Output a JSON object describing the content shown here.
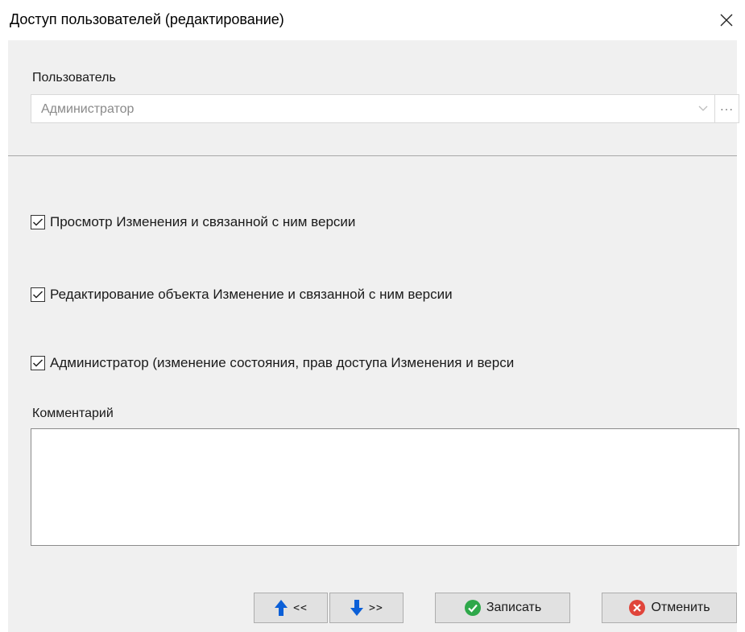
{
  "window": {
    "title": "Доступ пользователей (редактирование)",
    "close_icon": "close-icon"
  },
  "user_field": {
    "label": "Пользователь",
    "value": "Администратор",
    "dropdown_icon": "chevron-down-icon",
    "ellipsis_label": "···"
  },
  "permissions": [
    {
      "label": "Просмотр Изменения и связанной с ним версии",
      "checked": true
    },
    {
      "label": "Редактирование объекта Изменение и связанной с ним версии",
      "checked": true
    },
    {
      "label": "Администратор (изменение состояния, прав доступа Изменения и верси",
      "checked": true
    }
  ],
  "comment": {
    "label": "Комментарий",
    "value": ""
  },
  "buttons": {
    "prev_label": "<<",
    "next_label": ">>",
    "save_label": "Записать",
    "cancel_label": "Отменить"
  },
  "colors": {
    "accent_blue": "#0b5fd7",
    "save_green": "#2ea84a",
    "cancel_red": "#e0443a"
  }
}
